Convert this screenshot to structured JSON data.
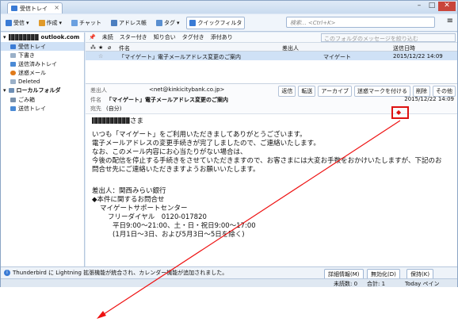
{
  "window": {
    "tab_title": "受信トレイ",
    "controls": [
      "–",
      "□",
      "✕"
    ]
  },
  "toolbar": {
    "receive": "受信",
    "compose": "作成",
    "chat": "チャット",
    "address_book": "アドレス帳",
    "tag": "タグ",
    "quick_filter": "クイックフィルタ",
    "search_placeholder": "検索... <Ctrl+K>",
    "menu": "≡"
  },
  "accounts": {
    "main": "outlook.com",
    "local": "ローカルフォルダ"
  },
  "folders": {
    "inbox": "受信トレイ",
    "drafts": "下書き",
    "sent": "送信済みトレイ",
    "junk": "迷惑メール",
    "deleted": "Deleted",
    "trash": "ごみ箱",
    "outbox": "送信トレイ"
  },
  "filterbar": {
    "unread": "未読",
    "starred": "スター付き",
    "contacts": "知り合い",
    "tagged": "タグ付き",
    "attach": "添付あり",
    "placeholder": "このフォルダのメッセージを絞り込む <Ctrl+Shift+K>"
  },
  "list": {
    "headers": {
      "subject": "件名",
      "from": "差出人",
      "date": "送信日時"
    },
    "row": {
      "subject": "「マイゲート」電子メールアドレス変更のご案内",
      "from": "マイゲート",
      "date": "2015/12/22 14:09"
    }
  },
  "message": {
    "from_label": "差出人",
    "from_value": "<net@kinkicitybank.co.jp>",
    "subject_label": "件名",
    "subject_value": "「マイゲート」電子メールアドレス変更のご案内",
    "to_label": "宛先",
    "to_value": "(自分)",
    "date": "2015/12/22 14:09",
    "buttons": {
      "reply": "返信",
      "forward": "転送",
      "archive": "アーカイブ",
      "junk": "迷惑マークを付ける",
      "delete": "削除",
      "other": "その他"
    },
    "greeting": "さま",
    "lines": [
      "いつも「マイゲート」をご利用いただきましてありがとうございます。",
      "電子メールアドレスの変更手続きが完了しましたので、ご連絡いたします。",
      "なお、このメール内容にお心当たりがない場合は、",
      "今後の配信を停止する手続きをさせていただきますので、お客さまには大変お手数をおかけいたしますが、下記のお",
      "問合せ先にご連絡いただきますようお願いいたします。"
    ],
    "sender": "差出人：関西みらい銀行",
    "contact_title": "◆本件に関するお問合せ",
    "contact": [
      "マイゲートサポートセンター",
      "フリーダイヤル　0120-017820",
      "平日9:00～21:00、土・日・祝日9:00～17:00",
      "(1月1日～3日、および5月3日～5日を除く)"
    ]
  },
  "notification": {
    "text": "Thunderbird に Lightning 拡張機能が統合され、カレンダー機能が追加されました。",
    "details": "詳細情報(M)",
    "disable": "無効化(D)",
    "keep": "保持(K)"
  },
  "status": {
    "unread": "未読数: 0",
    "total": "合計: 1",
    "today": "Today ペイン"
  }
}
